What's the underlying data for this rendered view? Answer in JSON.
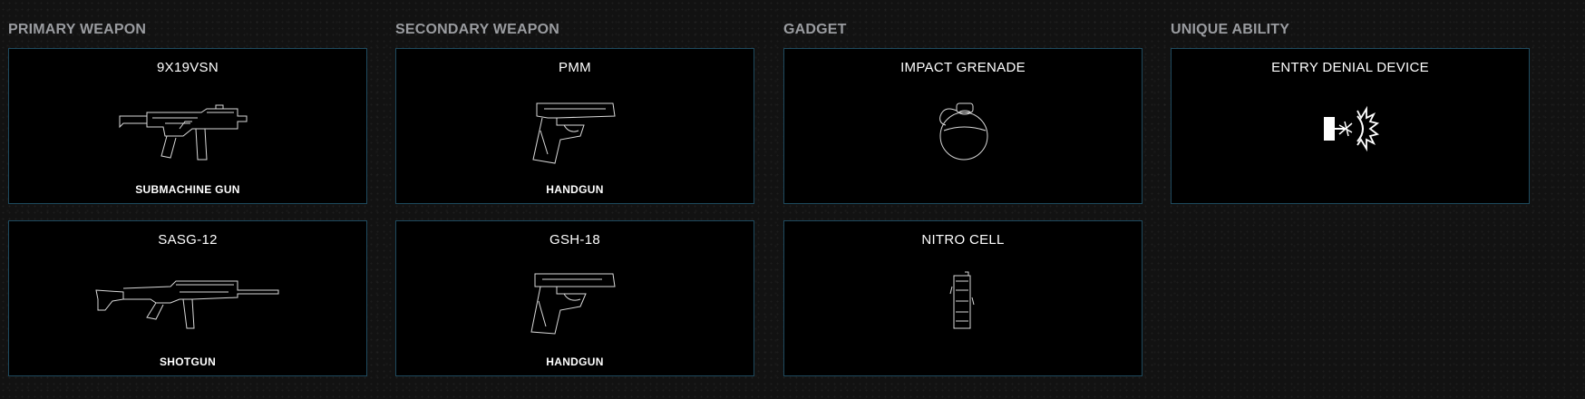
{
  "loadout": {
    "primary": {
      "title": "PRIMARY WEAPON",
      "items": [
        {
          "name": "9X19VSN",
          "type": "SUBMACHINE GUN",
          "icon": "smg-icon"
        },
        {
          "name": "SASG-12",
          "type": "SHOTGUN",
          "icon": "shotgun-icon"
        }
      ]
    },
    "secondary": {
      "title": "SECONDARY WEAPON",
      "items": [
        {
          "name": "PMM",
          "type": "HANDGUN",
          "icon": "pistol-icon"
        },
        {
          "name": "GSH-18",
          "type": "HANDGUN",
          "icon": "pistol-icon"
        }
      ]
    },
    "gadget": {
      "title": "GADGET",
      "items": [
        {
          "name": "IMPACT GRENADE",
          "icon": "grenade-icon"
        },
        {
          "name": "NITRO CELL",
          "icon": "nitro-cell-icon"
        }
      ]
    },
    "ability": {
      "title": "UNIQUE ABILITY",
      "items": [
        {
          "name": "ENTRY DENIAL DEVICE",
          "icon": "entry-denial-device-icon"
        }
      ]
    }
  },
  "colors": {
    "background": "#121212",
    "card": "#000000",
    "card_border": "#1e4a5e",
    "section_title": "#9a9ca0",
    "text": "#ffffff"
  }
}
